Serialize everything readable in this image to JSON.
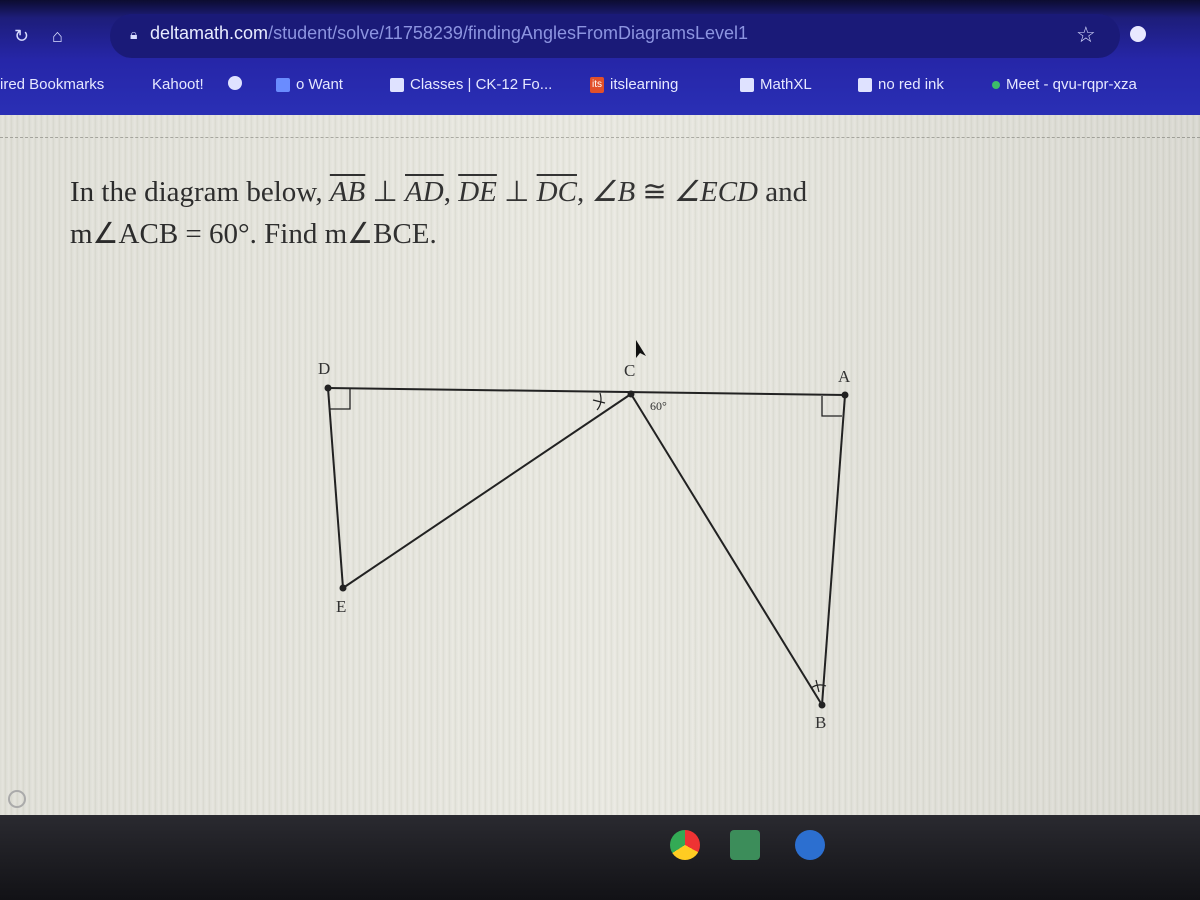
{
  "browser": {
    "url_domain": "deltamath.com",
    "url_path": "/student/solve/11758239/findingAnglesFromDiagramsLevel1",
    "bookmarks": [
      {
        "label": "ired Bookmarks",
        "icon": "none"
      },
      {
        "label": "Kahoot!",
        "icon": "none"
      },
      {
        "label": "",
        "icon": "circle-s-icon"
      },
      {
        "label": "o Want",
        "icon": "form-icon"
      },
      {
        "label": "Classes | CK-12 Fo...",
        "icon": "doc-icon"
      },
      {
        "label": "itslearning",
        "icon": "its-icon",
        "icon_text": "its"
      },
      {
        "label": "MathXL",
        "icon": "folder-icon"
      },
      {
        "label": "no red ink",
        "icon": "folder-icon"
      },
      {
        "label": "Meet - qvu-rqpr-xza",
        "icon": "meet-icon"
      }
    ]
  },
  "problem": {
    "line1_prefix": "In the diagram below,",
    "seg1": "AB",
    "perp": "⊥",
    "seg2": "AD",
    "seg3": "DE",
    "seg4": "DC",
    "angle_b": "∠B",
    "congruent": "≅",
    "angle_ecd": "∠ECD",
    "and": "and",
    "line2": "m∠ACB = 60°. Find m∠BCE."
  },
  "diagram": {
    "points": {
      "D": "D",
      "C": "C",
      "A": "A",
      "E": "E",
      "B": "B"
    },
    "angle_label": "60°"
  }
}
